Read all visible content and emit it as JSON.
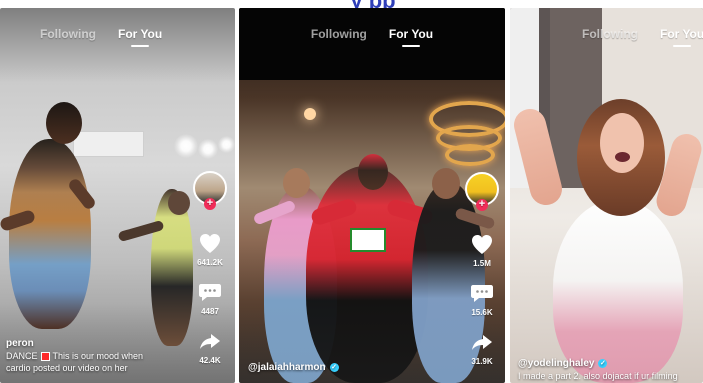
{
  "banner": {
    "partial_text": "y      pp"
  },
  "screens": [
    {
      "tabs": {
        "following": "Following",
        "for_you": "For You"
      },
      "sidebar": {
        "likes": "641.2K",
        "comments": "4487",
        "shares": "42.4K"
      },
      "caption": {
        "handle": "peron",
        "line1_before": "DANCE",
        "line1_after": "This is our mood when",
        "line2": "cardio posted our video on her"
      },
      "icons": {
        "avatar": "creator-avatar",
        "follow": "plus-icon",
        "like": "heart-icon",
        "comment": "comment-icon",
        "share": "share-icon"
      }
    },
    {
      "tabs": {
        "following": "Following",
        "for_you": "For You"
      },
      "sidebar": {
        "likes": "1.5M",
        "comments": "15.6K",
        "shares": "31.9K"
      },
      "caption": {
        "handle": "@jalaiahharmon"
      },
      "icons": {
        "avatar": "creator-avatar",
        "follow": "plus-icon",
        "like": "heart-icon",
        "comment": "comment-icon",
        "share": "share-icon",
        "verified": "verified-icon"
      }
    },
    {
      "tabs": {
        "following": "Following",
        "for_you": "For You"
      },
      "caption": {
        "handle": "@yodelinghaley",
        "line1": "I made a part 2. also dojacat if ur filming"
      },
      "icons": {
        "verified": "verified-icon"
      }
    }
  ],
  "colors": {
    "follow_accent": "#f02d59",
    "verified_badge": "#39d1ff",
    "banner_text": "#2f3fb8"
  }
}
